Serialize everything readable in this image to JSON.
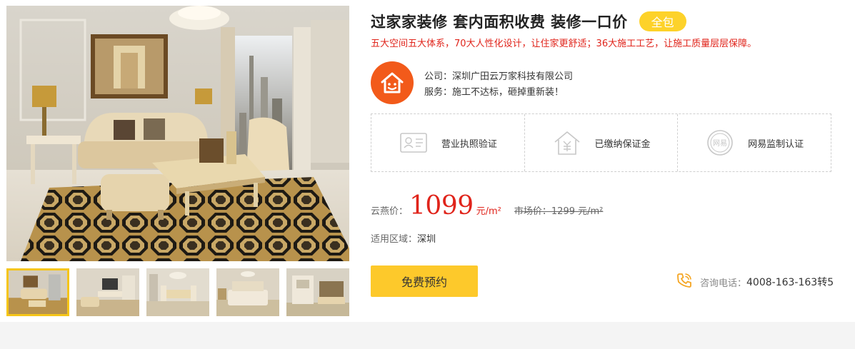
{
  "product": {
    "title": "过家家装修 套内面积收费 装修一口价",
    "badge": "全包",
    "subtitle": "五大空间五大体系，70大人性化设计，让住家更舒适；36大施工工艺，让施工质量层层保障。"
  },
  "company": {
    "logo_icon": "house-smile-icon",
    "name_line": "公司：深圳广田云万家科技有限公司",
    "service_line": "服务：施工不达标，砸掉重新装！"
  },
  "certifications": [
    {
      "icon": "license-icon",
      "label": "营业执照验证"
    },
    {
      "icon": "deposit-house-icon",
      "label": "已缴纳保证金"
    },
    {
      "icon": "netease-seal-icon",
      "label": "网易监制认证"
    }
  ],
  "price": {
    "label": "云燕价：",
    "value": "1099",
    "unit": "元/m²",
    "market": "市场价：1299 元/m²"
  },
  "area": {
    "label": "适用区域：",
    "value": "深圳"
  },
  "booking": {
    "button_label": "免费预约"
  },
  "phone": {
    "icon": "phone-ring-icon",
    "label": "咨询电话：",
    "number": "4008-163-163转5"
  },
  "colors": {
    "accent_yellow": "#fdc92b",
    "price_red": "#e0241b",
    "logo_orange": "#f25a1a"
  },
  "thumbnails": {
    "count": 5,
    "active_index": 0
  }
}
